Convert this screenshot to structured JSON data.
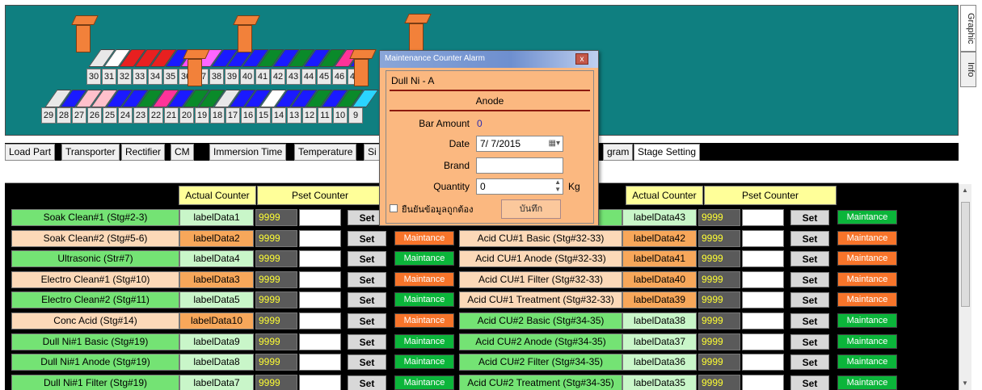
{
  "side_tabs": [
    "Graphic",
    "Info"
  ],
  "graphic": {
    "top_row_numbers": [
      "30",
      "31",
      "32",
      "33",
      "34",
      "35",
      "36",
      "37",
      "38",
      "39",
      "40",
      "41",
      "42",
      "43",
      "44",
      "45",
      "46",
      "47"
    ],
    "bottom_row_numbers": [
      "29",
      "28",
      "27",
      "26",
      "25",
      "24",
      "23",
      "22",
      "21",
      "20",
      "19",
      "18",
      "17",
      "16",
      "15",
      "14",
      "13",
      "12",
      "11",
      "10",
      "9"
    ],
    "top_stripe_colors": [
      "#e8e8e8",
      "#ffffff",
      "#e82020",
      "#e82020",
      "#e82020",
      "#1a1aff",
      "#ff4dff",
      "#ff66ff",
      "#1a1aff",
      "#1a1aff",
      "#1a1aff",
      "#0a8a2a",
      "#1a1aff",
      "#0a8a2a",
      "#1a1aff",
      "#0a8a2a",
      "#ff3399",
      "#1a1aff"
    ],
    "bottom_stripe_colors": [
      "#e8e8e8",
      "#1a1aff",
      "#ffc0cb",
      "#ffc0cb",
      "#1a1aff",
      "#1a1aff",
      "#0a8a2a",
      "#ff3399",
      "#1a1aff",
      "#0a8a2a",
      "#0a8a2a",
      "#e8e8e8",
      "#1a1aff",
      "#1a1aff",
      "#ffffff",
      "#1a1aff",
      "#1a1aff",
      "#0a8a2a",
      "#1a1aff",
      "#0a8a2a",
      "#2ad4ff"
    ]
  },
  "tabs": [
    "Load Part",
    "Transporter",
    "Rectifier",
    "CM",
    "Immersion Time",
    "Temperature",
    "Si",
    "gram",
    "Stage Setting"
  ],
  "table": {
    "headers": {
      "actual_counter_left": "Actual Counter",
      "pset_counter_left": "Pset Counter",
      "actual_counter_right": "Actual Counter",
      "pset_counter_right": "Pset Counter"
    },
    "pset_value": "9999",
    "set_label": "Set",
    "maint_label": "Maintance",
    "left_rows": [
      {
        "name": "Soak Clean#1 (Stg#2-3)",
        "data": "labelData1",
        "name_color": "green",
        "data_color": "lblue",
        "maint_color": "dgreen"
      },
      {
        "name": "Soak Clean#2 (Stg#5-6)",
        "data": "labelData2",
        "name_color": "peach",
        "data_color": "lorange",
        "maint_color": "orange"
      },
      {
        "name": "Ultrasonic (Str#7)",
        "data": "labelData4",
        "name_color": "green",
        "data_color": "lblue",
        "maint_color": "dgreen"
      },
      {
        "name": "Electro Clean#1 (Stg#10)",
        "data": "labelData3",
        "name_color": "peach",
        "data_color": "lorange",
        "maint_color": "orange"
      },
      {
        "name": "Electro Clean#2 (Stg#11)",
        "data": "labelData5",
        "name_color": "green",
        "data_color": "lblue",
        "maint_color": "dgreen"
      },
      {
        "name": "Conc Acid (Stg#14)",
        "data": "labelData10",
        "name_color": "peach",
        "data_color": "lorange",
        "maint_color": "orange"
      },
      {
        "name": "Dull Ni#1 Basic (Stg#19)",
        "data": "labelData9",
        "name_color": "green",
        "data_color": "lblue",
        "maint_color": "dgreen"
      },
      {
        "name": "Dull Ni#1 Anode (Stg#19)",
        "data": "labelData8",
        "name_color": "green",
        "data_color": "lblue",
        "maint_color": "dgreen"
      },
      {
        "name": "Dull Ni#1 Filter (Stg#19)",
        "data": "labelData7",
        "name_color": "green",
        "data_color": "lblue",
        "maint_color": "dgreen"
      }
    ],
    "right_rows": [
      {
        "name": "",
        "data": "labelData43",
        "name_color": "green",
        "data_color": "lblue",
        "maint_color": "dgreen"
      },
      {
        "name": "Acid CU#1 Basic (Stg#32-33)",
        "data": "labelData42",
        "name_color": "peach",
        "data_color": "lorange",
        "maint_color": "orange"
      },
      {
        "name": "Acid CU#1 Anode (Stg#32-33)",
        "data": "labelData41",
        "name_color": "peach",
        "data_color": "lorange",
        "maint_color": "orange"
      },
      {
        "name": "Acid CU#1 Filter (Stg#32-33)",
        "data": "labelData40",
        "name_color": "peach",
        "data_color": "lorange",
        "maint_color": "orange"
      },
      {
        "name": "Acid CU#1 Treatment (Stg#32-33)",
        "data": "labelData39",
        "name_color": "peach",
        "data_color": "lorange",
        "maint_color": "orange"
      },
      {
        "name": "Acid CU#2 Basic (Stg#34-35)",
        "data": "labelData38",
        "name_color": "green",
        "data_color": "lblue",
        "maint_color": "dgreen"
      },
      {
        "name": "Acid CU#2 Anode (Stg#34-35)",
        "data": "labelData37",
        "name_color": "green",
        "data_color": "lblue",
        "maint_color": "dgreen"
      },
      {
        "name": "Acid CU#2 Filter (Stg#34-35)",
        "data": "labelData36",
        "name_color": "green",
        "data_color": "lblue",
        "maint_color": "dgreen"
      },
      {
        "name": "Acid CU#2 Treatment (Stg#34-35)",
        "data": "labelData35",
        "name_color": "green",
        "data_color": "lblue",
        "maint_color": "dgreen"
      }
    ]
  },
  "dialog": {
    "title": "Maintenance Counter Alarm",
    "close_icon": "x",
    "item": "Dull Ni - A",
    "section": "Anode",
    "bar_amount_label": "Bar Amount",
    "bar_amount_value": "0",
    "date_label": "Date",
    "date_value": "7/ 7/2015",
    "brand_label": "Brand",
    "brand_value": "",
    "quantity_label": "Quantity",
    "quantity_value": "0",
    "quantity_unit": "Kg",
    "confirm_label": "ยืนยันข้อมูลถูกต้อง",
    "save_label": "บันทึก"
  }
}
